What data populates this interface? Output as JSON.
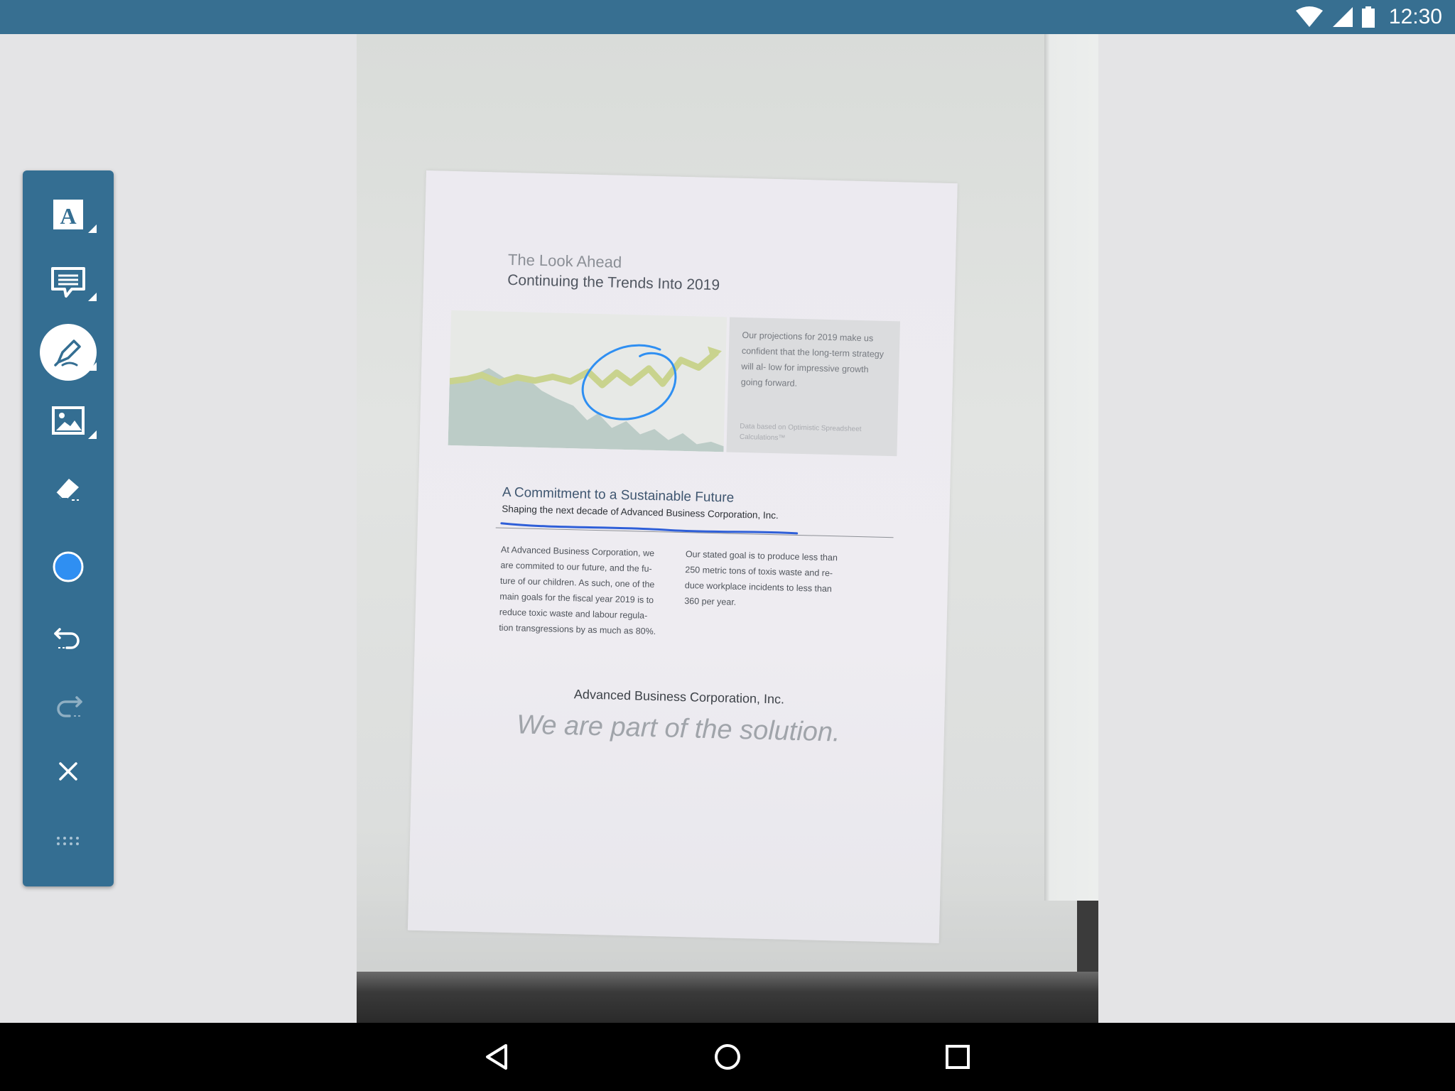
{
  "status_bar": {
    "time": "12:30",
    "icons": [
      "wifi-icon",
      "signal-icon",
      "battery-icon"
    ]
  },
  "toolbar": {
    "tools": [
      {
        "name": "text",
        "icon": "text-A-icon",
        "has_submenu": true
      },
      {
        "name": "comment",
        "icon": "comment-icon",
        "has_submenu": true
      },
      {
        "name": "pen",
        "icon": "pen-icon",
        "has_submenu": true,
        "active": true
      },
      {
        "name": "image",
        "icon": "image-icon",
        "has_submenu": true
      },
      {
        "name": "eraser",
        "icon": "eraser-icon"
      },
      {
        "name": "color",
        "icon": "color-swatch-icon",
        "color": "#2f8ff2"
      },
      {
        "name": "undo",
        "icon": "undo-icon"
      },
      {
        "name": "redo",
        "icon": "redo-icon",
        "disabled": true
      },
      {
        "name": "close",
        "icon": "close-icon"
      },
      {
        "name": "drag-handle",
        "icon": "drag-handle-icon"
      }
    ],
    "accent": "#346e92"
  },
  "document": {
    "eyebrow": "The Look Ahead",
    "title": "Continuing the Trends Into 2019",
    "sidebox_text": "Our projections for 2019 make us confident that the long-term strategy will al- low for impressive growth going forward.",
    "sidebox_note": "Data based on Optimistic Spreadsheet Calculations™",
    "section_heading": "A Commitment to a Sustainable Future",
    "section_subheading": "Shaping the next decade of Advanced Business Corporation, Inc.",
    "col1": "At Advanced Business Corporation, we are commited to our future, and the fu- ture of our children. As such, one of the main goals for the fiscal year 2019 is to reduce toxic waste and labour regula- tion transgressions by as much as 80%.",
    "col2": "Our stated goal is to produce less than 250 metric tons of toxis waste and re- duce workplace incidents to less than 360 per year.",
    "company": "Advanced Business Corporation, Inc.",
    "slogan": "We are part of the solution.",
    "ink_color": "#2f8ff2"
  },
  "nav_bar": {
    "buttons": [
      "back-icon",
      "home-icon",
      "recents-icon"
    ]
  }
}
